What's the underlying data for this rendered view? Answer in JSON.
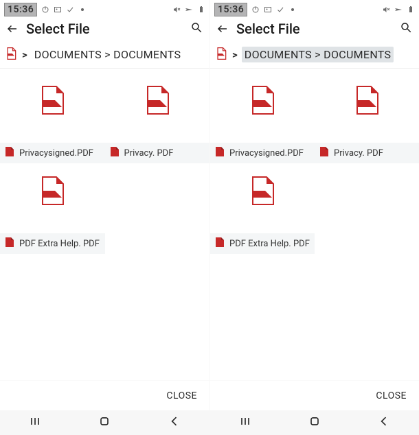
{
  "screens": [
    {
      "status": {
        "clock": "15:36",
        "left": [
          "power-icon",
          "picture-icon",
          "check-icon",
          "dot"
        ],
        "right": [
          "mute-icon",
          "airplane-icon",
          "battery-icon"
        ]
      },
      "appbar": {
        "title": "Select File"
      },
      "breadcrumb": {
        "path_prefix": ">",
        "path": "DOCUMENTS > DOCUMENTS",
        "highlighted": false
      },
      "grid": [
        {
          "name": "Privacysigned.PDF"
        },
        {
          "name": "Privacy. PDF"
        },
        {
          "name": "PDF Extra Help. PDF"
        }
      ],
      "close": "CLOSE"
    },
    {
      "status": {
        "clock": "15:36",
        "left": [
          "power-icon",
          "picture-icon",
          "check-icon",
          "dot"
        ],
        "right": [
          "mute-icon",
          "airplane-icon",
          "battery-icon"
        ]
      },
      "appbar": {
        "title": "Select File"
      },
      "breadcrumb": {
        "path_prefix": ">",
        "path": "DOCUMENTS > DOCUMENTS",
        "highlighted": true
      },
      "grid": [
        {
          "name": "Privacysigned.PDF"
        },
        {
          "name": "Privacy. PDF"
        },
        {
          "name": "PDF Extra Help. PDF"
        }
      ],
      "close": "CLOSE"
    }
  ]
}
